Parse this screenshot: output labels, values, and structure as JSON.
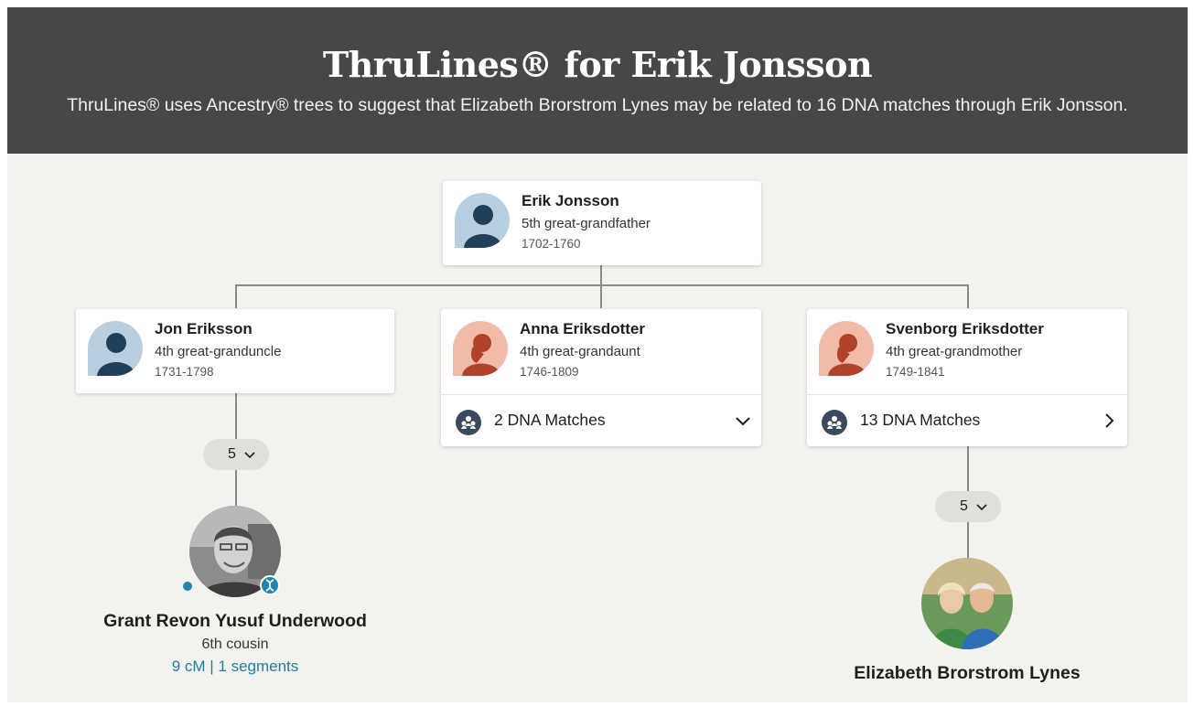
{
  "header": {
    "title": "ThruLines® for Erik Jonsson",
    "subtitle": "ThruLines® uses Ancestry® trees to suggest that Elizabeth Brorstrom Lynes may be related to 16 DNA matches through Erik Jonsson."
  },
  "root": {
    "name": "Erik Jonsson",
    "relationship": "5th great-grandfather",
    "dates": "1702-1760",
    "avatar_icon": "male-silhouette-icon"
  },
  "children": [
    {
      "name": "Jon Eriksson",
      "relationship": "4th great-granduncle",
      "dates": "1731-1798",
      "avatar_icon": "male-silhouette-icon"
    },
    {
      "name": "Anna Eriksdotter",
      "relationship": "4th great-grandaunt",
      "dates": "1746-1809",
      "avatar_icon": "female-silhouette-icon",
      "matches_label": "2 DNA Matches",
      "chevron_icon": "chevron-down-icon"
    },
    {
      "name": "Svenborg Eriksdotter",
      "relationship": "4th great-grandmother",
      "dates": "1749-1841",
      "avatar_icon": "female-silhouette-icon",
      "matches_label": "13 DNA Matches",
      "chevron_icon": "chevron-right-icon"
    }
  ],
  "generation_pills": [
    {
      "count": "5"
    },
    {
      "count": "5"
    }
  ],
  "match_person": {
    "name": "Grant Revon Yusuf Underwood",
    "relationship": "6th cousin",
    "shared_dna": "9 cM | 1 segments"
  },
  "home_person": {
    "name": "Elizabeth Brorstrom Lynes"
  },
  "colors": {
    "header_bg": "#474747",
    "canvas_bg": "#f4f2ef",
    "male_avatar_bg": "#b7cfdf",
    "female_avatar_bg": "#f1bca7",
    "link": "#227b9c"
  }
}
